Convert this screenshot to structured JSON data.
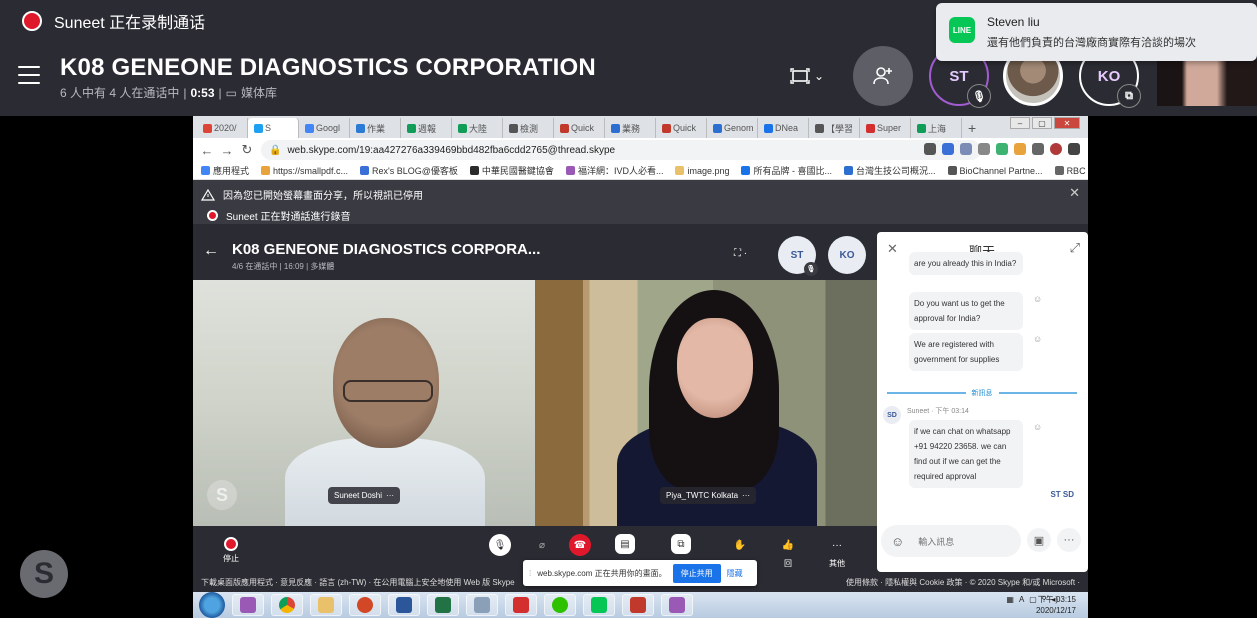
{
  "recording": {
    "text": "Suneet 正在录制通话"
  },
  "call": {
    "title": "K08 GENEONE DIAGNOSTICS CORPORATION",
    "participants_in_call": "6 人中有 4 人在通话中",
    "duration": "0:53",
    "media": "媒体库"
  },
  "header_avatars": {
    "st": "ST",
    "ko": "KO"
  },
  "notification": {
    "app": "LINE",
    "sender": "Steven liu",
    "message": "還有他們負責的台灣廠商實際有洽談的場次"
  },
  "browser": {
    "tabs": [
      "2020/",
      "S",
      "Googl",
      "作業",
      "週報",
      "大陸",
      "檢測",
      "Quick",
      "業務",
      "Quick",
      "Genom",
      "DNea",
      "【學習",
      "Super",
      "上海"
    ],
    "url": "web.skype.com/19:aa427276a339469bbd482fba6cdd2765@thread.skype",
    "bookmarks": [
      "應用程式",
      "https://smallpdf.c...",
      "Rex's BLOG@優客板",
      "中華民國醫鍵協會",
      "福洋網：IVD人必看...",
      "image.png",
      "所有品牌 - 喜國比...",
      "台灣生技公司概況...",
      "BioChannel Partne...",
      "RBC"
    ]
  },
  "inner": {
    "warning": "因為您已開始螢幕畫面分享，所以視訊已停用",
    "recording": "Suneet 正在對通話進行錄音",
    "title": "K08 GENEONE DIAGNOSTICS CORPORA...",
    "sub": "4/6 在通話中 | 16:09 | 多媒體",
    "avatars": {
      "st": "ST",
      "ko": "KO"
    },
    "participants": [
      {
        "name": "Suneet Doshi"
      },
      {
        "name": "Piya_TWTC Kolkata"
      }
    ],
    "controls": {
      "stop": "停止",
      "react": "回",
      "more": "其他"
    }
  },
  "chat": {
    "title": "聊天",
    "messages": [
      {
        "text": "are you already this in India?"
      },
      {
        "text": "Do you want us to get the approval for India?"
      },
      {
        "text": "We are registered with government for supplies"
      }
    ],
    "new_label": "新訊息",
    "sender": "Suneet",
    "sender_initials": "SD",
    "time": "下午 03:14",
    "last_message": "if we can chat on whatsapp +91 94220 23658. we can find out if we can get the required approval",
    "seen": "ST SD",
    "placeholder": "輸入訊息"
  },
  "footer": {
    "left": "下載桌面版應用程式 · 意見反應 · 語言 (zh-TW) · 在公用電腦上安全地使用 Web 版 Skype",
    "right": "使用條款 · 隱私權與 Cookie 政策 · © 2020 Skype 和/或 Microsoft ·"
  },
  "share_banner": {
    "text": "web.skype.com 正在共用你的畫面。",
    "stop": "停止共用",
    "hide": "隱藏"
  },
  "taskbar": {
    "time": "下午 03:15",
    "date": "2020/12/17"
  },
  "colors": {
    "header_bg": "#2b2c33",
    "record_red": "#e0182b",
    "line_green": "#06c755",
    "chat_link": "#1c8bd0"
  }
}
